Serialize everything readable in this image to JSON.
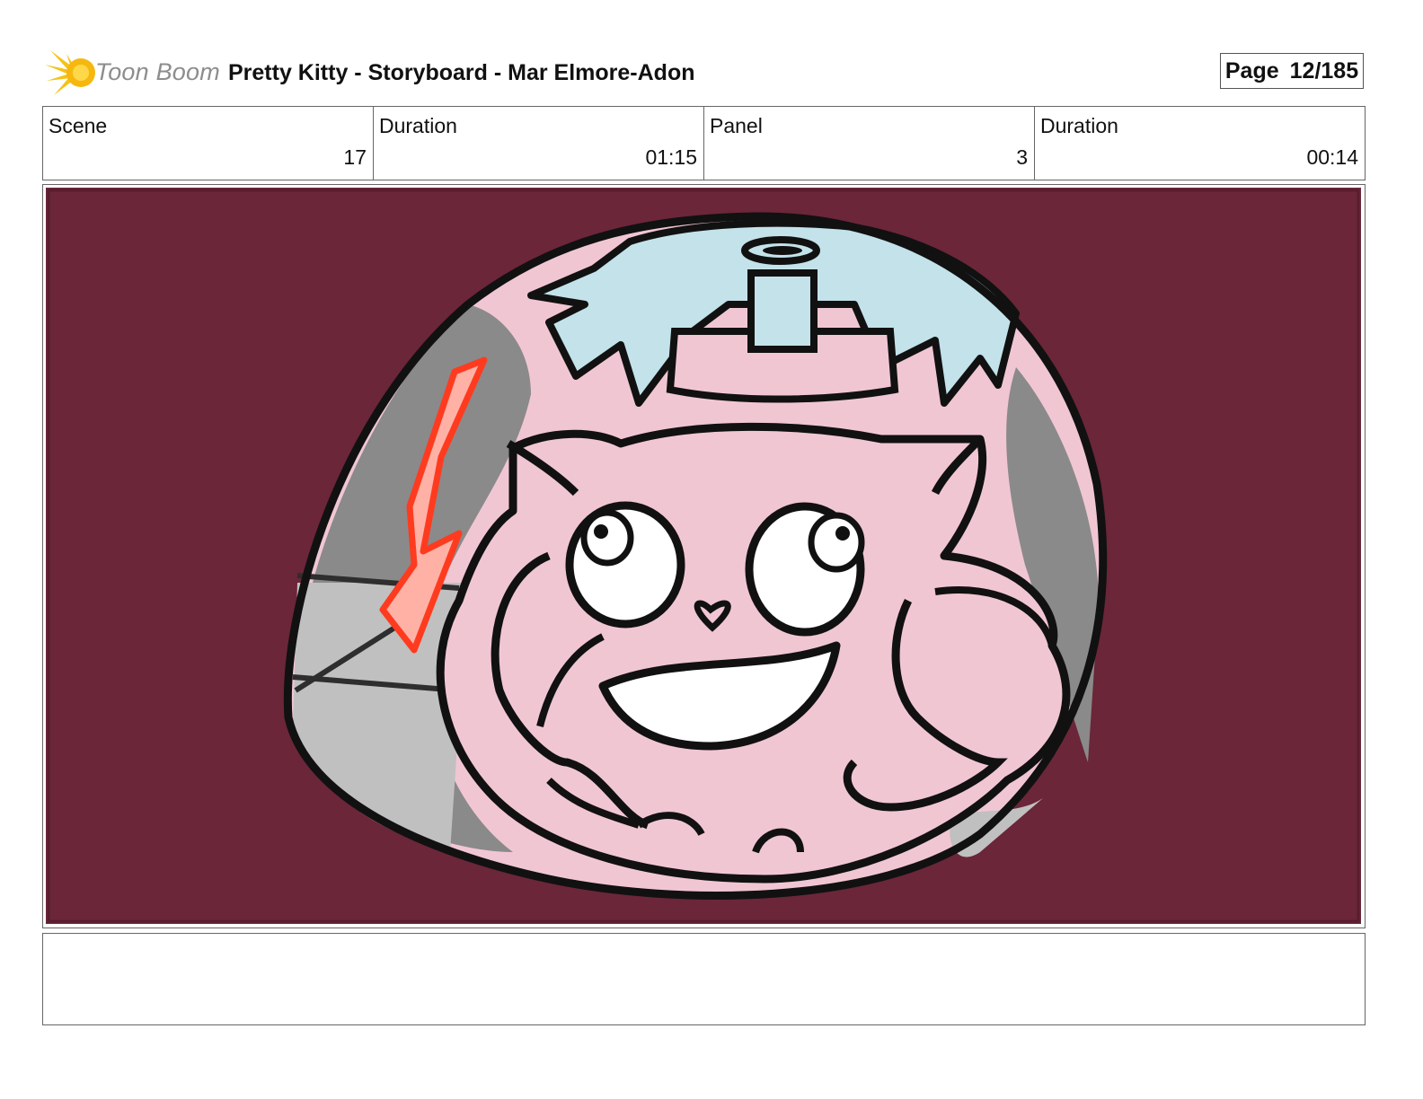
{
  "header": {
    "logo_text": "Toon Boom",
    "title": "Pretty Kitty - Storyboard - Mar Elmore-Adon",
    "page_label": "Page",
    "page_value": "12/185"
  },
  "info": {
    "scene_label": "Scene",
    "scene_value": "17",
    "scene_duration_label": "Duration",
    "scene_duration_value": "01:15",
    "panel_label": "Panel",
    "panel_value": "3",
    "panel_duration_label": "Duration",
    "panel_duration_value": "00:14"
  },
  "notes": {
    "text": ""
  },
  "colors": {
    "background_maroon": "#6b2639",
    "cat_pink": "#f1c6d3",
    "hair_blue": "#c3e2ea",
    "arrow_red": "#ff3b1f",
    "grey_shadow": "#8a8a8a",
    "grey_light": "#c0c0c0"
  },
  "icons": {
    "logo_icon": "toon-boom-star-burst-icon"
  }
}
